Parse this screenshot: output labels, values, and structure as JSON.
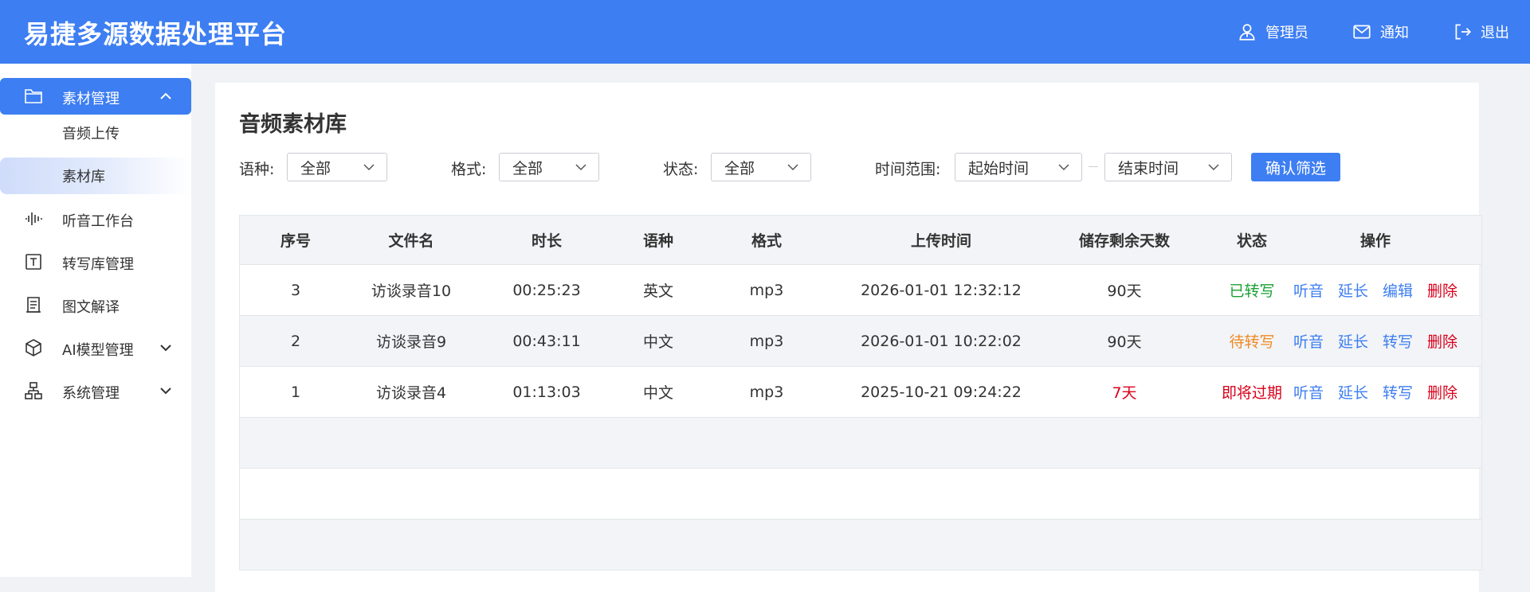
{
  "header": {
    "title": "易捷多源数据处理平台",
    "actions": [
      {
        "label": "管理员",
        "icon": "user-icon"
      },
      {
        "label": "通知",
        "icon": "mail-icon"
      },
      {
        "label": "退出",
        "icon": "logout-icon"
      }
    ]
  },
  "sidebar": {
    "group": {
      "label": "素材管理",
      "icon": "folder-icon",
      "expanded": true
    },
    "sub_items": [
      {
        "label": "音频上传",
        "active": false
      },
      {
        "label": "素材库",
        "active": true
      }
    ],
    "items": [
      {
        "label": "听音工作台",
        "icon": "audio-wave-icon"
      },
      {
        "label": "转写库管理",
        "icon": "text-box-icon"
      },
      {
        "label": "图文解译",
        "icon": "document-icon"
      },
      {
        "label": "AI模型管理",
        "icon": "cube-icon",
        "has_submenu": true
      },
      {
        "label": "系统管理",
        "icon": "hierarchy-icon",
        "has_submenu": true
      }
    ]
  },
  "main": {
    "title": "音频素材库",
    "filters": {
      "language": {
        "label": "语种:",
        "value": "全部"
      },
      "format": {
        "label": "格式:",
        "value": "全部"
      },
      "status": {
        "label": "状态:",
        "value": "全部"
      },
      "time_range": {
        "label": "时间范围:",
        "start_placeholder": "起始时间",
        "end_placeholder": "结束时间"
      },
      "confirm_label": "确认筛选"
    },
    "table": {
      "columns": [
        "序号",
        "文件名",
        "时长",
        "语种",
        "格式",
        "上传时间",
        "储存剩余天数",
        "状态",
        "操作"
      ],
      "rows": [
        {
          "no": "3",
          "name": "访谈录音10",
          "duration": "00:25:23",
          "lang": "英文",
          "format": "mp3",
          "time": "2026-01-01 12:32:12",
          "days": "90天",
          "status": "已转写",
          "ops": [
            "听音",
            "延长",
            "编辑",
            "删除"
          ]
        },
        {
          "no": "2",
          "name": "访谈录音9",
          "duration": "00:43:11",
          "lang": "中文",
          "format": "mp3",
          "time": "2026-01-01 10:22:02",
          "days": "90天",
          "status": "待转写",
          "ops": [
            "听音",
            "延长",
            "转写",
            "删除"
          ]
        },
        {
          "no": "1",
          "name": "访谈录音4",
          "duration": "01:13:03",
          "lang": "中文",
          "format": "mp3",
          "time": "2025-10-21 09:24:22",
          "days": "7天",
          "status": "即将过期",
          "ops": [
            "听音",
            "延长",
            "转写",
            "删除"
          ]
        }
      ]
    }
  },
  "colors": {
    "brand": "#3d7ef2",
    "success": "#1aa034",
    "warning": "#f08a24",
    "danger": "#d9001b"
  }
}
